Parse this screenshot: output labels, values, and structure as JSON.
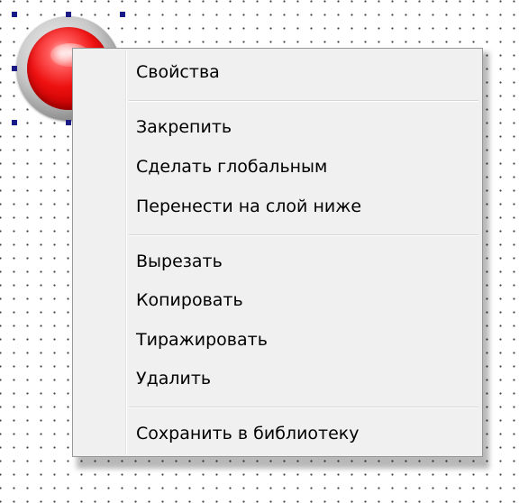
{
  "workspace": {
    "grid_dot_color": "#404040",
    "background_color": "#ffffff"
  },
  "lamp": {
    "icon": "red-indicator-lamp-icon",
    "color": "#ee1111",
    "selection_handle_color": "#1b1b86"
  },
  "context_menu": {
    "background_color": "#f0f0f0",
    "groups": [
      {
        "items": [
          {
            "label": "Свойства"
          }
        ]
      },
      {
        "items": [
          {
            "label": "Закрепить"
          },
          {
            "label": "Сделать глобальным"
          },
          {
            "label": "Перенести на слой ниже"
          }
        ]
      },
      {
        "items": [
          {
            "label": "Вырезать"
          },
          {
            "label": "Копировать"
          },
          {
            "label": "Тиражировать"
          },
          {
            "label": "Удалить"
          }
        ]
      },
      {
        "items": [
          {
            "label": "Сохранить в библиотеку"
          }
        ]
      }
    ]
  }
}
